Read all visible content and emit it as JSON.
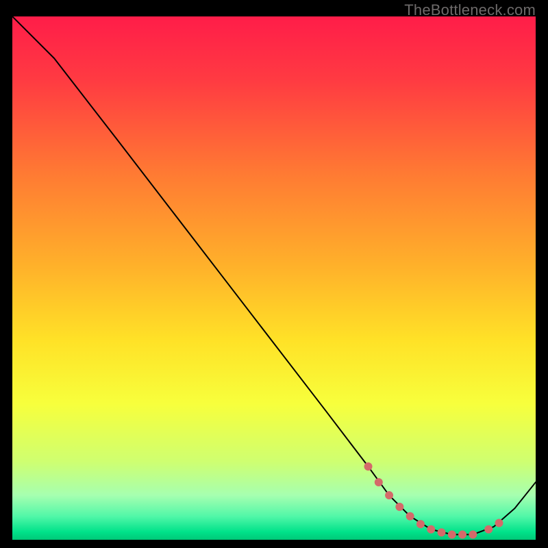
{
  "attribution": "TheBottleneck.com",
  "chart_data": {
    "type": "line",
    "title": "",
    "xlabel": "",
    "ylabel": "",
    "xlim": [
      0,
      100
    ],
    "ylim": [
      0,
      100
    ],
    "grid": false,
    "legend": false,
    "series": [
      {
        "name": "curve",
        "x": [
          0,
          8,
          20,
          30,
          40,
          50,
          60,
          68,
          72,
          76,
          80,
          84,
          88,
          92,
          96,
          100
        ],
        "y": [
          100,
          92,
          76.5,
          63.5,
          50.5,
          37.5,
          24.5,
          14,
          8.5,
          4.5,
          2.0,
          1.0,
          1.0,
          2.5,
          6.0,
          11.0
        ]
      }
    ],
    "markers": {
      "name": "dots",
      "color": "#d46a6a",
      "x": [
        68,
        70,
        72,
        74,
        76,
        78,
        80,
        82,
        84,
        86,
        88,
        91,
        93
      ],
      "y": [
        14,
        11,
        8.5,
        6.3,
        4.5,
        3.0,
        2.0,
        1.4,
        1.0,
        1.0,
        1.0,
        2.0,
        3.2
      ]
    },
    "background_gradient": {
      "type": "vertical",
      "stops": [
        {
          "offset": 0.0,
          "color": "#ff1d49"
        },
        {
          "offset": 0.12,
          "color": "#ff3a42"
        },
        {
          "offset": 0.3,
          "color": "#ff7a33"
        },
        {
          "offset": 0.48,
          "color": "#ffb22a"
        },
        {
          "offset": 0.62,
          "color": "#ffe227"
        },
        {
          "offset": 0.74,
          "color": "#f7ff3c"
        },
        {
          "offset": 0.85,
          "color": "#cfff70"
        },
        {
          "offset": 0.915,
          "color": "#a6ffb0"
        },
        {
          "offset": 0.955,
          "color": "#52f7a8"
        },
        {
          "offset": 0.985,
          "color": "#00e28a"
        },
        {
          "offset": 1.0,
          "color": "#00c878"
        }
      ]
    }
  }
}
